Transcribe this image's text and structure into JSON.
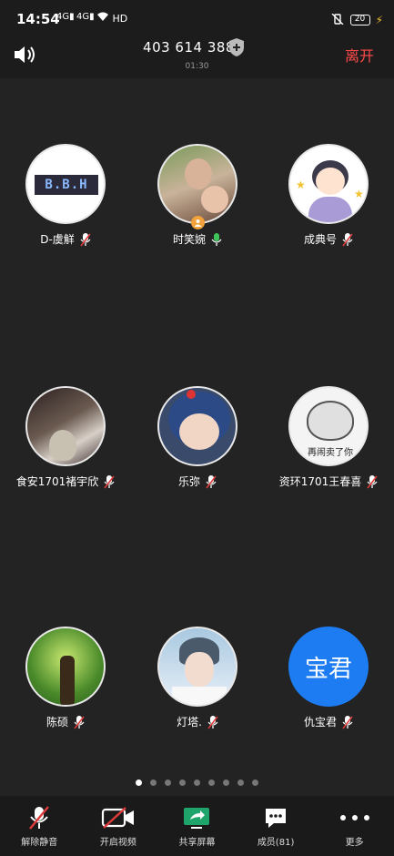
{
  "status_bar": {
    "time": "14:54",
    "signal_1": "4G",
    "signal_2": "4G",
    "wifi_label": "HD",
    "battery": "20"
  },
  "header": {
    "meeting_id": "403 614 388",
    "timer": "01:30",
    "leave_label": "离开"
  },
  "participants": [
    {
      "name": "D-虞觧",
      "mic": "muted",
      "avatar_text": "B.B.H"
    },
    {
      "name": "时笑婉",
      "mic": "on",
      "host": true
    },
    {
      "name": "成典号",
      "mic": "muted"
    },
    {
      "name": "食安1701褚宇欣",
      "mic": "muted"
    },
    {
      "name": "乐弥",
      "mic": "muted"
    },
    {
      "name": "资环1701王春喜",
      "mic": "muted",
      "avatar_text": "再闹卖了你"
    },
    {
      "name": "陈硕",
      "mic": "muted"
    },
    {
      "name": "灯塔.",
      "mic": "muted"
    },
    {
      "name": "仇宝君",
      "mic": "muted",
      "avatar_text": "宝君"
    }
  ],
  "pagination": {
    "pages": 9,
    "active_index": 0
  },
  "toolbar": {
    "unmute": "解除静音",
    "start_video": "开启视频",
    "share_screen": "共享屏幕",
    "members": "成员(81)",
    "more": "更多"
  },
  "colors": {
    "leave": "#ff4a4a",
    "mic_on": "#3ec55a",
    "muted_slash": "#e03a3a",
    "host_badge": "#f2a23c",
    "share_green": "#1fa56b",
    "avatar_blue": "#1d7cf2"
  }
}
